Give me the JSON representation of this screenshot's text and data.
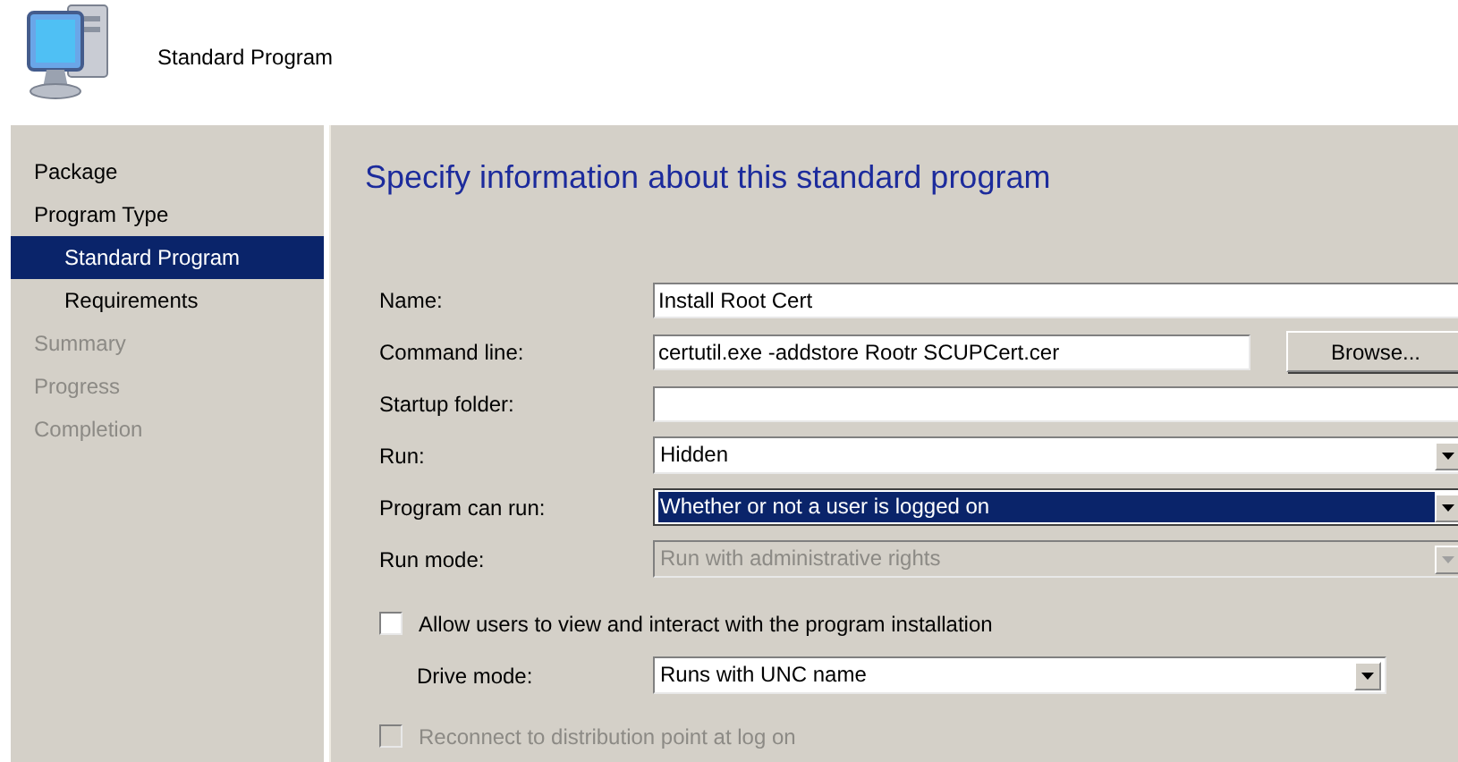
{
  "header": {
    "title": "Standard Program"
  },
  "sidebar": {
    "items": [
      {
        "label": "Package",
        "selected": false,
        "disabled": false
      },
      {
        "label": "Program Type",
        "selected": false,
        "disabled": false,
        "children": [
          {
            "label": "Standard Program",
            "selected": true,
            "disabled": false
          },
          {
            "label": "Requirements",
            "selected": false,
            "disabled": false
          }
        ]
      },
      {
        "label": "Summary",
        "selected": false,
        "disabled": true
      },
      {
        "label": "Progress",
        "selected": false,
        "disabled": true
      },
      {
        "label": "Completion",
        "selected": false,
        "disabled": true
      }
    ]
  },
  "page": {
    "heading": "Specify information about this standard program"
  },
  "fields": [
    {
      "kind": "text",
      "label": "Name:",
      "value": "Install Root Cert",
      "disabled": false
    },
    {
      "kind": "text",
      "label": "Command line:",
      "value": "certutil.exe -addstore Rootr SCUPCert.cer",
      "button": "Browse...",
      "disabled": false
    },
    {
      "kind": "text",
      "label": "Startup folder:",
      "disabled": false
    },
    {
      "kind": "dropdown",
      "label": "Run:",
      "value": "Hidden",
      "disabled": false,
      "highlighted": false
    },
    {
      "kind": "dropdown",
      "label": "Program can run:",
      "value": "Whether or not a user is logged on",
      "disabled": false,
      "highlighted": true
    },
    {
      "kind": "dropdown",
      "label": "Run mode:",
      "value": "Run with administrative rights",
      "disabled": true,
      "highlighted": false
    }
  ],
  "options": [
    {
      "kind": "checkbox",
      "label": "Allow users to view and interact with the program installation",
      "checked": false,
      "disabled": false
    },
    {
      "kind": "dropdown",
      "label": "Drive mode:",
      "value": "Runs with UNC name",
      "disabled": false,
      "highlighted": false
    },
    {
      "kind": "checkbox",
      "label": "Reconnect to distribution point at log on",
      "checked": false,
      "disabled": true
    }
  ]
}
